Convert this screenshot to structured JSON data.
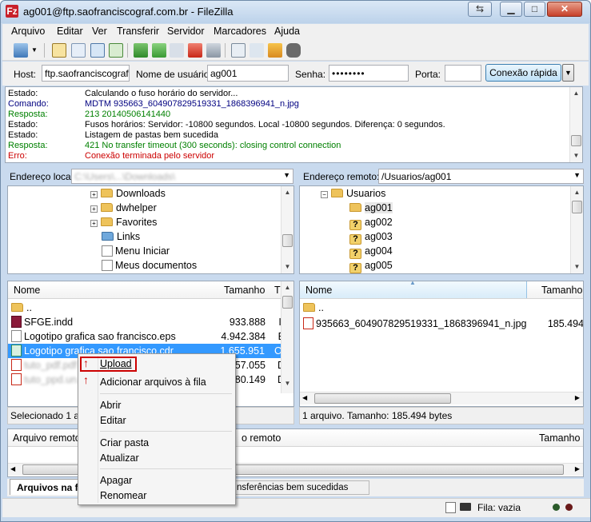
{
  "window": {
    "title": "ag001@ftp.saofranciscograf.com.br - FileZilla",
    "app_icon": "Fz"
  },
  "menu": [
    "Arquivo",
    "Editar",
    "Ver",
    "Transferir",
    "Servidor",
    "Marcadores",
    "Ajuda"
  ],
  "quickconnect": {
    "host_label": "Host:",
    "host_value": "ftp.saofranciscograf.",
    "user_label": "Nome de usuário:",
    "user_value": "ag001",
    "pass_label": "Senha:",
    "pass_value": "••••••••",
    "port_label": "Porta:",
    "port_value": "",
    "connect_label": "Conexão rápida"
  },
  "log": [
    {
      "key": "Estado:",
      "text": "Calculando o fuso horário do servidor...",
      "color": "#000000"
    },
    {
      "key": "Comando:",
      "text": "MDTM 935663_604907829519331_1868396941_n.jpg",
      "color": "#000080"
    },
    {
      "key": "Resposta:",
      "text": "213 20140506141440",
      "color": "#008000"
    },
    {
      "key": "Estado:",
      "text": "Fusos horários: Servidor: -10800 segundos. Local -10800 segundos. Diferença: 0 segundos.",
      "color": "#000000"
    },
    {
      "key": "Estado:",
      "text": "Listagem de pastas bem sucedida",
      "color": "#000000"
    },
    {
      "key": "Resposta:",
      "text": "421 No transfer timeout (300 seconds): closing control connection",
      "color": "#008000"
    },
    {
      "key": "Erro:",
      "text": "Conexão terminada pelo servidor",
      "color": "#cc0000"
    }
  ],
  "local": {
    "address_label": "Endereço local:",
    "address_value": "C:\\Users\\...\\Downloads\\",
    "tree": [
      "Downloads",
      "dwhelper",
      "Favorites",
      "Links",
      "Menu Iniciar",
      "Meus documentos"
    ],
    "columns": [
      "Nome",
      "Tamanho",
      "T"
    ],
    "files": [
      {
        "name": "..",
        "size": "",
        "type": ""
      },
      {
        "name": "SFGE.indd",
        "size": "933.888",
        "type": "Ir"
      },
      {
        "name": "Logotipo grafica sao francisco.eps",
        "size": "4.942.384",
        "type": "E"
      },
      {
        "name": "Logotipo grafica sao francisco.cdr",
        "size": "1.655.951",
        "type": "C"
      },
      {
        "name": "tuto_pdf.pdf",
        "size": "557.055",
        "type": "D"
      },
      {
        "name": "tuto_ppd.un...",
        "size": "180.149",
        "type": "D"
      }
    ],
    "status": "Selecionado 1 ar"
  },
  "remote": {
    "address_label": "Endereço remoto:",
    "address_value": "/Usuarios/ag001",
    "tree": [
      "Usuarios",
      "ag001",
      "ag002",
      "ag003",
      "ag004",
      "ag005"
    ],
    "columns": [
      "Nome",
      "Tamanho"
    ],
    "files": [
      {
        "name": "..",
        "size": ""
      },
      {
        "name": "935663_604907829519331_1868396941_n.jpg",
        "size": "185.494"
      }
    ],
    "status": "1 arquivo. Tamanho: 185.494 bytes"
  },
  "queue": {
    "col_remote_file": "Arquivo remoto",
    "col_remote": "o remoto",
    "col_size": "Tamanho",
    "tab_queued": "Arquivos na fi",
    "tab_success": "nsferências bem sucedidas",
    "status": "Fila: vazia"
  },
  "context_menu": [
    "Upload",
    "Adicionar arquivos à fila",
    "Abrir",
    "Editar",
    "Criar pasta",
    "Atualizar",
    "Apagar",
    "Renomear"
  ],
  "colors": {
    "accent": "#3399ff",
    "highlight": "#cc0000",
    "selection": "#3399ff"
  }
}
